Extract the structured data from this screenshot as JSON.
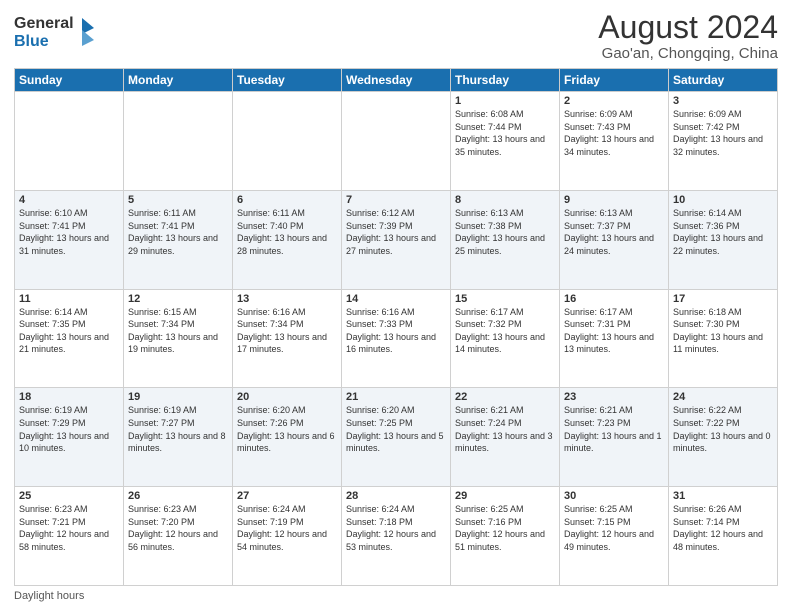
{
  "header": {
    "logo_general": "General",
    "logo_blue": "Blue",
    "title": "August 2024",
    "subtitle": "Gao'an, Chongqing, China"
  },
  "days_of_week": [
    "Sunday",
    "Monday",
    "Tuesday",
    "Wednesday",
    "Thursday",
    "Friday",
    "Saturday"
  ],
  "footer_label": "Daylight hours",
  "weeks": [
    [
      {
        "day": "",
        "sunrise": "",
        "sunset": "",
        "daylight": "",
        "empty": true
      },
      {
        "day": "",
        "sunrise": "",
        "sunset": "",
        "daylight": "",
        "empty": true
      },
      {
        "day": "",
        "sunrise": "",
        "sunset": "",
        "daylight": "",
        "empty": true
      },
      {
        "day": "",
        "sunrise": "",
        "sunset": "",
        "daylight": "",
        "empty": true
      },
      {
        "day": "1",
        "sunrise": "Sunrise: 6:08 AM",
        "sunset": "Sunset: 7:44 PM",
        "daylight": "Daylight: 13 hours and 35 minutes."
      },
      {
        "day": "2",
        "sunrise": "Sunrise: 6:09 AM",
        "sunset": "Sunset: 7:43 PM",
        "daylight": "Daylight: 13 hours and 34 minutes."
      },
      {
        "day": "3",
        "sunrise": "Sunrise: 6:09 AM",
        "sunset": "Sunset: 7:42 PM",
        "daylight": "Daylight: 13 hours and 32 minutes."
      }
    ],
    [
      {
        "day": "4",
        "sunrise": "Sunrise: 6:10 AM",
        "sunset": "Sunset: 7:41 PM",
        "daylight": "Daylight: 13 hours and 31 minutes."
      },
      {
        "day": "5",
        "sunrise": "Sunrise: 6:11 AM",
        "sunset": "Sunset: 7:41 PM",
        "daylight": "Daylight: 13 hours and 29 minutes."
      },
      {
        "day": "6",
        "sunrise": "Sunrise: 6:11 AM",
        "sunset": "Sunset: 7:40 PM",
        "daylight": "Daylight: 13 hours and 28 minutes."
      },
      {
        "day": "7",
        "sunrise": "Sunrise: 6:12 AM",
        "sunset": "Sunset: 7:39 PM",
        "daylight": "Daylight: 13 hours and 27 minutes."
      },
      {
        "day": "8",
        "sunrise": "Sunrise: 6:13 AM",
        "sunset": "Sunset: 7:38 PM",
        "daylight": "Daylight: 13 hours and 25 minutes."
      },
      {
        "day": "9",
        "sunrise": "Sunrise: 6:13 AM",
        "sunset": "Sunset: 7:37 PM",
        "daylight": "Daylight: 13 hours and 24 minutes."
      },
      {
        "day": "10",
        "sunrise": "Sunrise: 6:14 AM",
        "sunset": "Sunset: 7:36 PM",
        "daylight": "Daylight: 13 hours and 22 minutes."
      }
    ],
    [
      {
        "day": "11",
        "sunrise": "Sunrise: 6:14 AM",
        "sunset": "Sunset: 7:35 PM",
        "daylight": "Daylight: 13 hours and 21 minutes."
      },
      {
        "day": "12",
        "sunrise": "Sunrise: 6:15 AM",
        "sunset": "Sunset: 7:34 PM",
        "daylight": "Daylight: 13 hours and 19 minutes."
      },
      {
        "day": "13",
        "sunrise": "Sunrise: 6:16 AM",
        "sunset": "Sunset: 7:34 PM",
        "daylight": "Daylight: 13 hours and 17 minutes."
      },
      {
        "day": "14",
        "sunrise": "Sunrise: 6:16 AM",
        "sunset": "Sunset: 7:33 PM",
        "daylight": "Daylight: 13 hours and 16 minutes."
      },
      {
        "day": "15",
        "sunrise": "Sunrise: 6:17 AM",
        "sunset": "Sunset: 7:32 PM",
        "daylight": "Daylight: 13 hours and 14 minutes."
      },
      {
        "day": "16",
        "sunrise": "Sunrise: 6:17 AM",
        "sunset": "Sunset: 7:31 PM",
        "daylight": "Daylight: 13 hours and 13 minutes."
      },
      {
        "day": "17",
        "sunrise": "Sunrise: 6:18 AM",
        "sunset": "Sunset: 7:30 PM",
        "daylight": "Daylight: 13 hours and 11 minutes."
      }
    ],
    [
      {
        "day": "18",
        "sunrise": "Sunrise: 6:19 AM",
        "sunset": "Sunset: 7:29 PM",
        "daylight": "Daylight: 13 hours and 10 minutes."
      },
      {
        "day": "19",
        "sunrise": "Sunrise: 6:19 AM",
        "sunset": "Sunset: 7:27 PM",
        "daylight": "Daylight: 13 hours and 8 minutes."
      },
      {
        "day": "20",
        "sunrise": "Sunrise: 6:20 AM",
        "sunset": "Sunset: 7:26 PM",
        "daylight": "Daylight: 13 hours and 6 minutes."
      },
      {
        "day": "21",
        "sunrise": "Sunrise: 6:20 AM",
        "sunset": "Sunset: 7:25 PM",
        "daylight": "Daylight: 13 hours and 5 minutes."
      },
      {
        "day": "22",
        "sunrise": "Sunrise: 6:21 AM",
        "sunset": "Sunset: 7:24 PM",
        "daylight": "Daylight: 13 hours and 3 minutes."
      },
      {
        "day": "23",
        "sunrise": "Sunrise: 6:21 AM",
        "sunset": "Sunset: 7:23 PM",
        "daylight": "Daylight: 13 hours and 1 minute."
      },
      {
        "day": "24",
        "sunrise": "Sunrise: 6:22 AM",
        "sunset": "Sunset: 7:22 PM",
        "daylight": "Daylight: 13 hours and 0 minutes."
      }
    ],
    [
      {
        "day": "25",
        "sunrise": "Sunrise: 6:23 AM",
        "sunset": "Sunset: 7:21 PM",
        "daylight": "Daylight: 12 hours and 58 minutes."
      },
      {
        "day": "26",
        "sunrise": "Sunrise: 6:23 AM",
        "sunset": "Sunset: 7:20 PM",
        "daylight": "Daylight: 12 hours and 56 minutes."
      },
      {
        "day": "27",
        "sunrise": "Sunrise: 6:24 AM",
        "sunset": "Sunset: 7:19 PM",
        "daylight": "Daylight: 12 hours and 54 minutes."
      },
      {
        "day": "28",
        "sunrise": "Sunrise: 6:24 AM",
        "sunset": "Sunset: 7:18 PM",
        "daylight": "Daylight: 12 hours and 53 minutes."
      },
      {
        "day": "29",
        "sunrise": "Sunrise: 6:25 AM",
        "sunset": "Sunset: 7:16 PM",
        "daylight": "Daylight: 12 hours and 51 minutes."
      },
      {
        "day": "30",
        "sunrise": "Sunrise: 6:25 AM",
        "sunset": "Sunset: 7:15 PM",
        "daylight": "Daylight: 12 hours and 49 minutes."
      },
      {
        "day": "31",
        "sunrise": "Sunrise: 6:26 AM",
        "sunset": "Sunset: 7:14 PM",
        "daylight": "Daylight: 12 hours and 48 minutes."
      }
    ]
  ]
}
